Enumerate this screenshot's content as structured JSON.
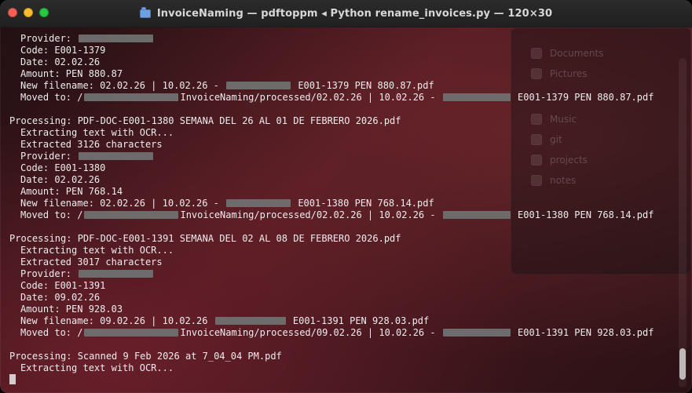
{
  "window": {
    "title": "InvoiceNaming — pdftoppm ◂ Python rename_invoices.py — 120×30",
    "traffic_lights": [
      "close",
      "minimize",
      "zoom"
    ]
  },
  "terminal": {
    "lines": [
      {
        "kind": "redacted",
        "indent": true,
        "prefix": "Provider: ",
        "redacts": [
          95
        ],
        "suffix": ""
      },
      {
        "kind": "text",
        "indent": true,
        "text": "Code: E001-1379"
      },
      {
        "kind": "text",
        "indent": true,
        "text": "Date: 02.02.26"
      },
      {
        "kind": "text",
        "indent": true,
        "text": "Amount: PEN 880.87"
      },
      {
        "kind": "redacted",
        "indent": true,
        "prefix": "New filename: 02.02.26 | 10.02.26 - ",
        "redacts": [
          82
        ],
        "suffix": " E001-1379 PEN 880.87.pdf"
      },
      {
        "kind": "redacted",
        "indent": true,
        "prefix": "Moved to: /",
        "redacts": [
          120
        ],
        "suffix": "InvoiceNaming/processed/02.02.26 | 10.02.26 - ",
        "redacts2": [
          86
        ],
        "suffix2": " E001-1379 PEN 880.87.pdf"
      },
      {
        "kind": "blank"
      },
      {
        "kind": "text",
        "indent": false,
        "text": "Processing: PDF-DOC-E001-1380 SEMANA DEL 26 AL 01 DE FEBRERO 2026.pdf"
      },
      {
        "kind": "text",
        "indent": true,
        "text": "Extracting text with OCR..."
      },
      {
        "kind": "text",
        "indent": true,
        "text": "Extracted 3126 characters"
      },
      {
        "kind": "redacted",
        "indent": true,
        "prefix": "Provider: ",
        "redacts": [
          95
        ],
        "suffix": ""
      },
      {
        "kind": "text",
        "indent": true,
        "text": "Code: E001-1380"
      },
      {
        "kind": "text",
        "indent": true,
        "text": "Date: 02.02.26"
      },
      {
        "kind": "text",
        "indent": true,
        "text": "Amount: PEN 768.14"
      },
      {
        "kind": "redacted",
        "indent": true,
        "prefix": "New filename: 02.02.26 | 10.02.26 - ",
        "redacts": [
          82
        ],
        "suffix": " E001-1380 PEN 768.14.pdf"
      },
      {
        "kind": "redacted",
        "indent": true,
        "prefix": "Moved to: /",
        "redacts": [
          120
        ],
        "suffix": "InvoiceNaming/processed/02.02.26 | 10.02.26 - ",
        "redacts2": [
          86
        ],
        "suffix2": " E001-1380 PEN 768.14.pdf"
      },
      {
        "kind": "blank"
      },
      {
        "kind": "text",
        "indent": false,
        "text": "Processing: PDF-DOC-E001-1391 SEMANA DEL 02 AL 08 DE FEBRERO 2026.pdf"
      },
      {
        "kind": "text",
        "indent": true,
        "text": "Extracting text with OCR..."
      },
      {
        "kind": "text",
        "indent": true,
        "text": "Extracted 3017 characters"
      },
      {
        "kind": "redacted",
        "indent": true,
        "prefix": "Provider: ",
        "redacts": [
          95
        ],
        "suffix": ""
      },
      {
        "kind": "text",
        "indent": true,
        "text": "Code: E001-1391"
      },
      {
        "kind": "text",
        "indent": true,
        "text": "Date: 09.02.26"
      },
      {
        "kind": "text",
        "indent": true,
        "text": "Amount: PEN 928.03"
      },
      {
        "kind": "redacted",
        "indent": true,
        "prefix": "New filename: 09.02.26 | 10.02.26 ",
        "redacts": [
          90
        ],
        "suffix": " E001-1391 PEN 928.03.pdf"
      },
      {
        "kind": "redacted",
        "indent": true,
        "prefix": "Moved to: /",
        "redacts": [
          120
        ],
        "suffix": "InvoiceNaming/processed/09.02.26 | 10.02.26 - ",
        "redacts2": [
          86
        ],
        "suffix2": " E001-1391 PEN 928.03.pdf"
      },
      {
        "kind": "blank"
      },
      {
        "kind": "text",
        "indent": false,
        "text": "Processing: Scanned 9 Feb 2026 at 7_04_04 PM.pdf"
      },
      {
        "kind": "text",
        "indent": true,
        "text": "Extracting text with OCR..."
      },
      {
        "kind": "cursor"
      }
    ]
  },
  "background": {
    "panel_items": [
      "Documents",
      "Pictures",
      "Music",
      "git",
      "projects",
      "notes"
    ]
  },
  "colors": {
    "terminal_text": "#EDEDED",
    "redaction": "#707070"
  }
}
